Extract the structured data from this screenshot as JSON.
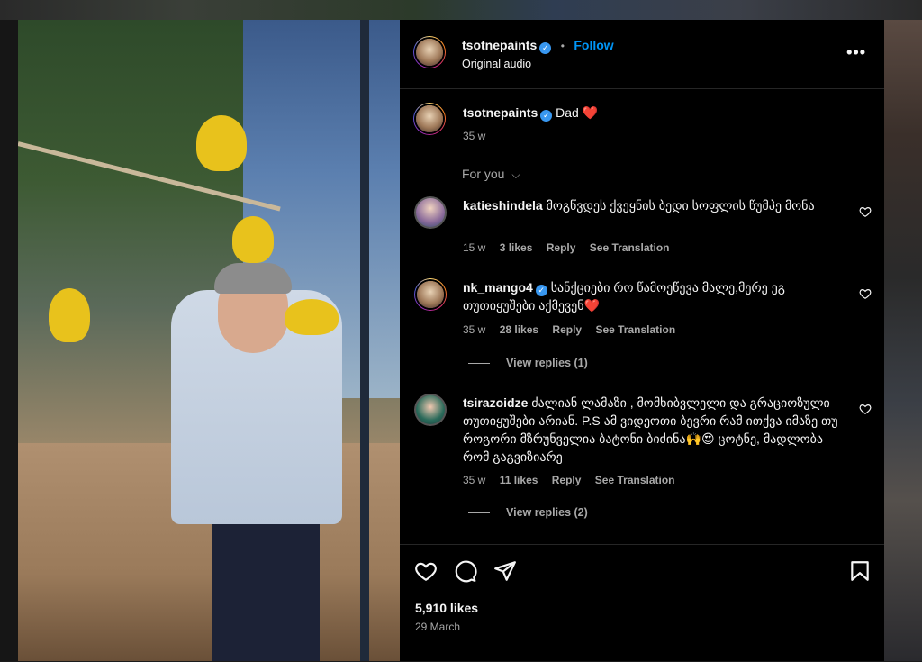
{
  "post": {
    "author": "tsotnepaints",
    "audio": "Original audio",
    "follow_label": "Follow",
    "separator": "•",
    "more_label": "•••",
    "verified_mark": "✓",
    "caption_text": "Dad",
    "caption_emoji": "❤️",
    "caption_time": "35 w"
  },
  "filter": {
    "label": "For you",
    "chevron": "⌵"
  },
  "comments": [
    {
      "user": "katieshindela",
      "verified": false,
      "text": "მოგწვდეს ქვეყნის ბედი სოფლის წუმპე მონა",
      "time": "15 w",
      "likes": "3 likes",
      "reply": "Reply",
      "translate": "See Translation"
    },
    {
      "user": "nk_mango4",
      "verified": true,
      "text": "სანქციები რო წამოეწევა მალე,მერე ეგ თუთიყუშები აქმევენ❤️",
      "time": "35 w",
      "likes": "28 likes",
      "reply": "Reply",
      "translate": "See Translation",
      "view_replies": "View replies (1)"
    },
    {
      "user": "tsirazoidze",
      "verified": false,
      "text": "ძალიან ლამაზი , მომხიბვლელი და გრაციოზული თუთიყუშები არიან. P.S ამ ვიდეოთი ბევრი რამ ითქვა იმაზე თუ როგორი მზრუნველია ბატონი ბიძინა🙌😍 ცოტნე, მადლობა რომ გაგვიზიარე",
      "time": "35 w",
      "likes": "11 likes",
      "reply": "Reply",
      "translate": "See Translation",
      "view_replies": "View replies (2)"
    }
  ],
  "footer": {
    "likes": "5,910 likes",
    "date": "29 March"
  },
  "icons": {
    "like": "heart-icon",
    "comment": "comment-icon",
    "share": "send-icon",
    "save": "bookmark-icon",
    "comment_like": "heart-icon"
  },
  "colors": {
    "panel_bg": "#000000",
    "text": "#f5f5f5",
    "muted": "#a8a8a8",
    "accent": "#0095f6",
    "verified": "#3897f0"
  }
}
